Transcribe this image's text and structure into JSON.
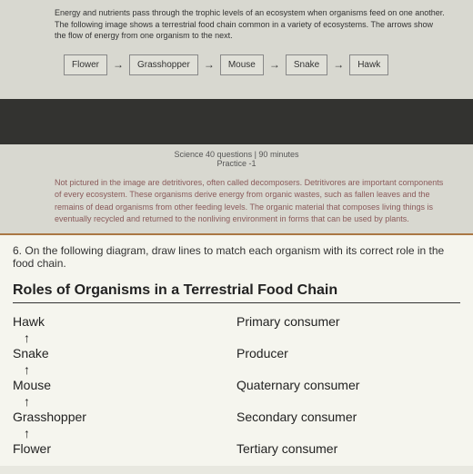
{
  "top": {
    "intro": "Energy and nutrients pass through the trophic levels of an ecosystem when organisms feed on one another. The following image shows a terrestrial food chain common in a variety of ecosystems. The arrows show the flow of energy from one organism to the next.",
    "chain": [
      "Flower",
      "Grasshopper",
      "Mouse",
      "Snake",
      "Hawk"
    ],
    "meta1": "Science 40 questions | 90 minutes",
    "meta2": "Practice -1",
    "detritivores": "Not pictured in the image are detritivores, often called decomposers. Detritivores are important components of every ecosystem. These organisms derive energy from organic wastes, such as fallen leaves and the remains of dead organisms from other feeding levels. The organic material that composes living things is eventually recycled and returned to the nonliving environment in forms that can be used by plants."
  },
  "question": {
    "number": "6.",
    "prompt": "On the following diagram, draw lines to match each organism with its correct role in the food chain.",
    "title": "Roles of Organisms in a Terrestrial Food Chain",
    "organisms": [
      "Hawk",
      "Snake",
      "Mouse",
      "Grasshopper",
      "Flower"
    ],
    "roles": [
      "Primary consumer",
      "Producer",
      "Quaternary consumer",
      "Secondary consumer",
      "Tertiary consumer"
    ]
  }
}
